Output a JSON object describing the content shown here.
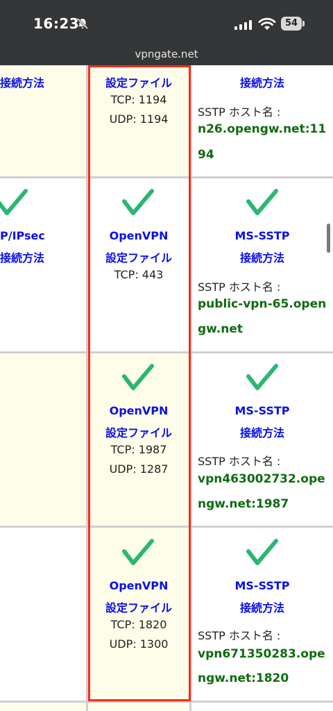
{
  "status": {
    "time": "16:23",
    "battery": "54"
  },
  "browser": {
    "url": "vpngate.net"
  },
  "rows": [
    {
      "left": {
        "label1": "接続方法"
      },
      "openvpn": {
        "config": "設定ファイル",
        "tcp": "TCP: 1194",
        "udp": "UDP: 1194"
      },
      "sstp": {
        "label": "接続方法",
        "host_label": "SSTP ホスト名 :",
        "host_line1": "n26.opengw.net:11",
        "host_line2": "94"
      }
    },
    {
      "left": {
        "label1": "P/IPsec",
        "label2": "接続方法"
      },
      "openvpn": {
        "title": "OpenVPN",
        "config": "設定ファイル",
        "tcp": "TCP: 443"
      },
      "sstp": {
        "title": "MS-SSTP",
        "label": "接続方法",
        "host_label": "SSTP ホスト名 :",
        "host_line1": "public-vpn-65.open",
        "host_line2": "gw.net"
      }
    },
    {
      "openvpn": {
        "title": "OpenVPN",
        "config": "設定ファイル",
        "tcp": "TCP: 1987",
        "udp": "UDP: 1287"
      },
      "sstp": {
        "title": "MS-SSTP",
        "label": "接続方法",
        "host_label": "SSTP ホスト名 :",
        "host_line1": "vpn463002732.ope",
        "host_line2": "ngw.net:1987"
      }
    },
    {
      "openvpn": {
        "title": "OpenVPN",
        "config": "設定ファイル",
        "tcp": "TCP: 1820",
        "udp": "UDP: 1300"
      },
      "sstp": {
        "title": "MS-SSTP",
        "label": "接続方法",
        "host_label": "SSTP ホスト名 :",
        "host_line1": "vpn671350283.ope",
        "host_line2": "ngw.net:1820"
      }
    }
  ],
  "colors": {
    "link": "#0b11e6",
    "host": "#0f6b0f",
    "check": "#2bb673",
    "highlight": "#ff2a1a"
  }
}
